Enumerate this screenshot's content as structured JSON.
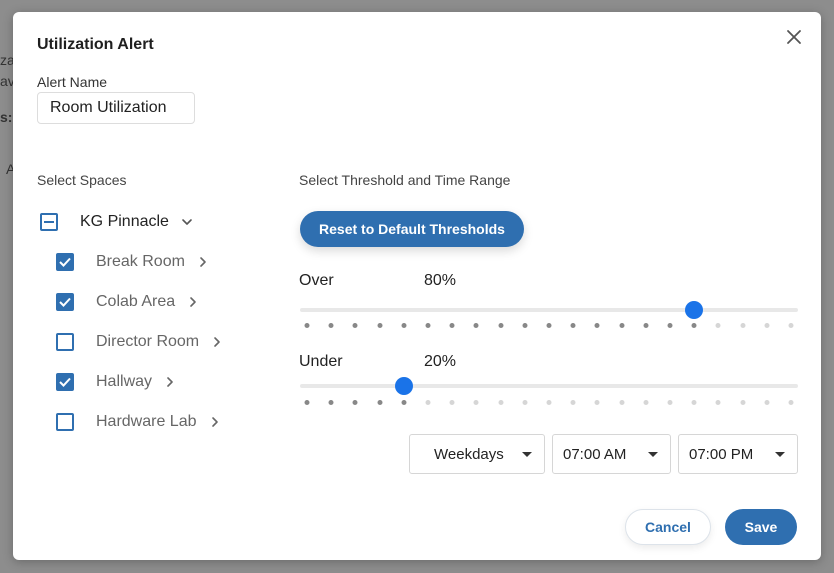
{
  "background": {
    "fragments": [
      "za",
      "av",
      "s:",
      "A"
    ]
  },
  "dialog": {
    "title": "Utilization Alert",
    "alert_name_label": "Alert Name",
    "alert_name_value": "Room Utilization",
    "spaces_label": "Select Spaces",
    "threshold_label": "Select Threshold and Time Range"
  },
  "spaces": {
    "parent": {
      "label": "KG Pinnacle",
      "state": "partial"
    },
    "children": [
      {
        "label": "Break Room",
        "checked": true
      },
      {
        "label": "Colab Area",
        "checked": true
      },
      {
        "label": "Director Room",
        "checked": false
      },
      {
        "label": "Hallway",
        "checked": true
      },
      {
        "label": "Hardware Lab",
        "checked": false
      }
    ]
  },
  "thresholds": {
    "reset_label": "Reset to Default Thresholds",
    "over": {
      "label": "Over",
      "value_text": "80%",
      "value": 80
    },
    "under": {
      "label": "Under",
      "value_text": "20%",
      "value": 20
    }
  },
  "time_range": {
    "days": "Weekdays",
    "start": "07:00 AM",
    "end": "07:00 PM"
  },
  "actions": {
    "cancel_label": "Cancel",
    "save_label": "Save"
  },
  "colors": {
    "accent": "#2f6fb0",
    "thumb": "#1a73e8",
    "dot_active": "#888888",
    "dot_inactive": "#d6d6d6"
  },
  "icons": {
    "close": "close-icon",
    "expand": "chevron-down-icon",
    "row_expand": "chevron-right-icon",
    "dropdown": "caret-down-icon"
  }
}
